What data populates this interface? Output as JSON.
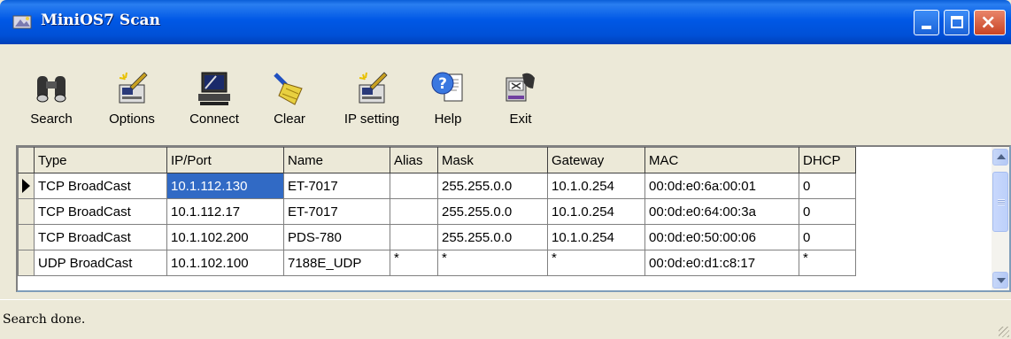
{
  "window": {
    "title": "MiniOS7 Scan",
    "title_icon": "scan-app-icon",
    "controls": {
      "minimize": "minimize-icon",
      "maximize": "maximize-icon",
      "close": "×"
    }
  },
  "toolbar": {
    "items": [
      {
        "label": "Search",
        "icon": "binoculars-icon"
      },
      {
        "label": "Options",
        "icon": "options-icon"
      },
      {
        "label": "Connect",
        "icon": "computer-icon"
      },
      {
        "label": "Clear",
        "icon": "broom-icon"
      },
      {
        "label": "IP setting",
        "icon": "ip-setting-icon"
      },
      {
        "label": "Help",
        "icon": "help-icon"
      },
      {
        "label": "Exit",
        "icon": "exit-icon"
      }
    ]
  },
  "grid": {
    "columns": [
      "Type",
      "IP/Port",
      "Name",
      "Alias",
      "Mask",
      "Gateway",
      "MAC",
      "DHCP"
    ],
    "rows": [
      {
        "type": "TCP BroadCast",
        "ip": "10.1.112.130",
        "name": "ET-7017",
        "alias": "",
        "mask": "255.255.0.0",
        "gateway": "10.1.0.254",
        "mac": "00:0d:e0:6a:00:01",
        "dhcp": "0"
      },
      {
        "type": "TCP BroadCast",
        "ip": "10.1.112.17",
        "name": "ET-7017",
        "alias": "",
        "mask": "255.255.0.0",
        "gateway": "10.1.0.254",
        "mac": "00:0d:e0:64:00:3a",
        "dhcp": "0"
      },
      {
        "type": "TCP BroadCast",
        "ip": "10.1.102.200",
        "name": "PDS-780",
        "alias": "",
        "mask": "255.255.0.0",
        "gateway": "10.1.0.254",
        "mac": "00:0d:e0:50:00:06",
        "dhcp": "0"
      },
      {
        "type": "UDP BroadCast",
        "ip": "10.1.102.100",
        "name": "7188E_UDP",
        "alias": "*",
        "mask": "*",
        "gateway": "*",
        "mac": "00:0d:e0:d1:c8:17",
        "dhcp": "*"
      }
    ]
  },
  "status": {
    "text": "Search done."
  }
}
